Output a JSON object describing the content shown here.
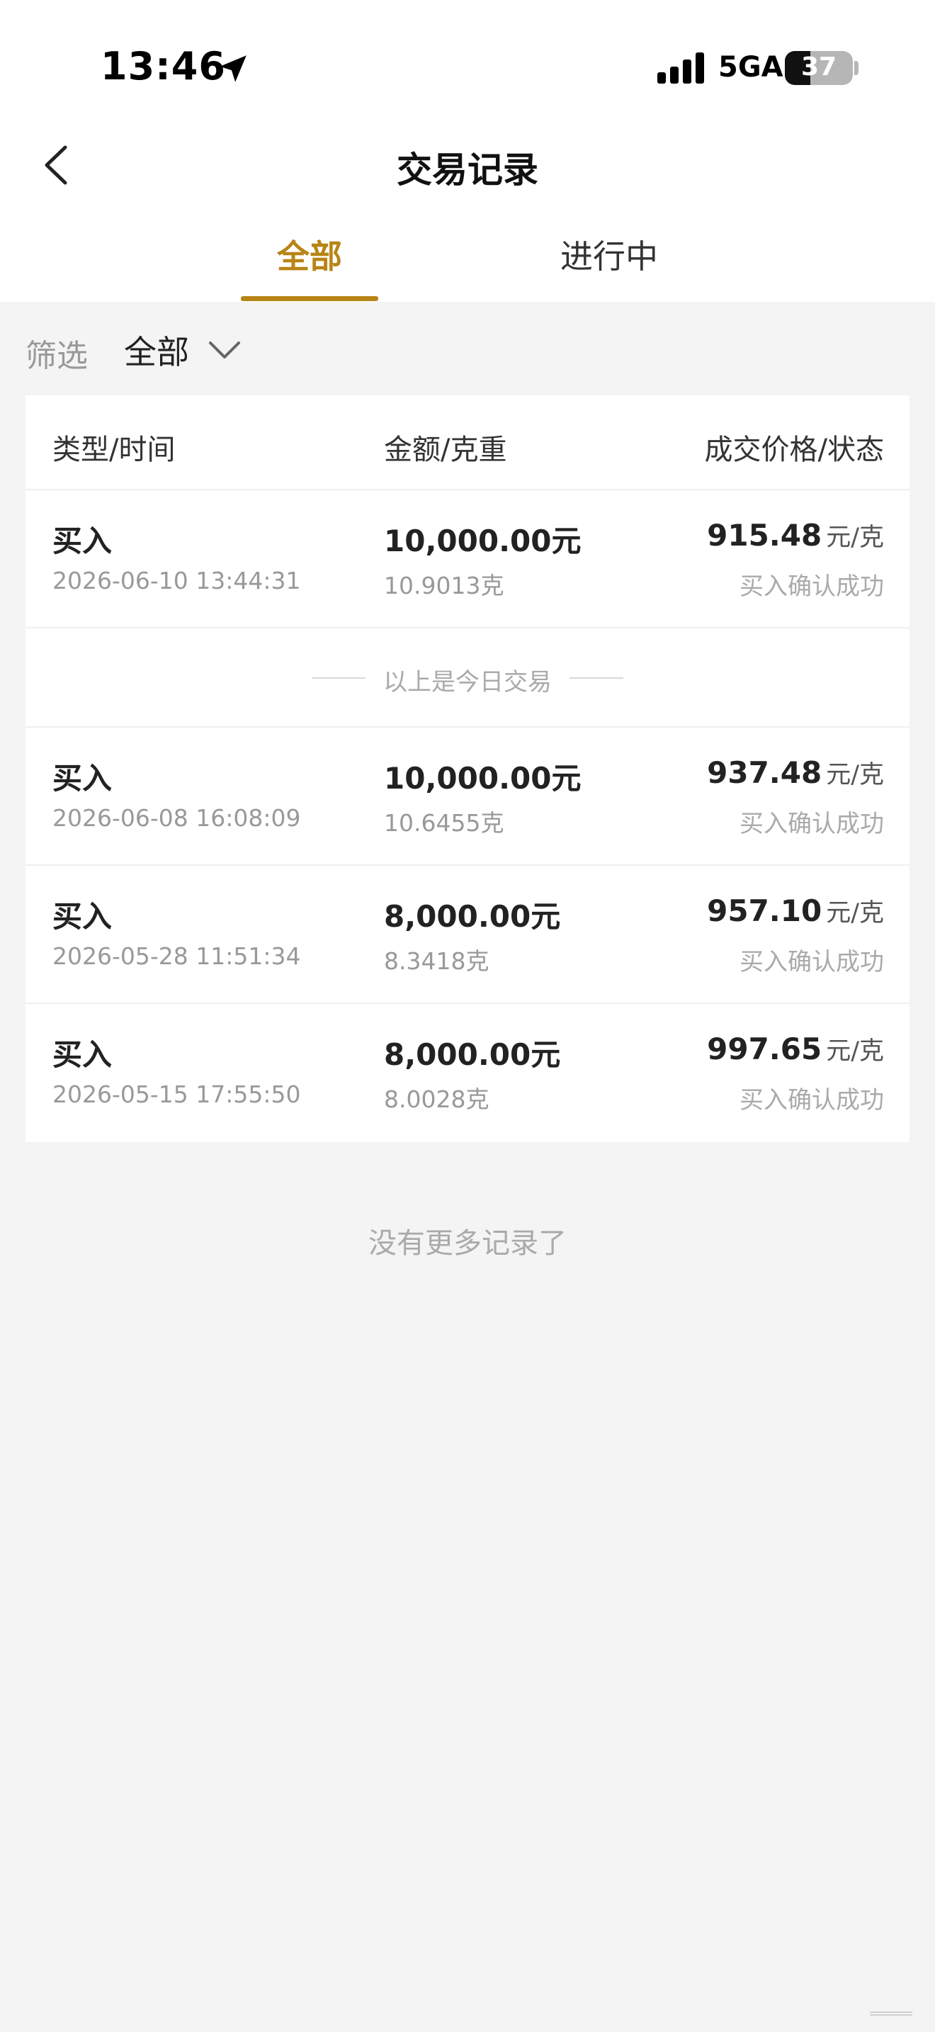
{
  "status_bar": {
    "time": "13:46",
    "network": "5GA",
    "battery": "37"
  },
  "nav": {
    "title": "交易记录"
  },
  "tabs": [
    {
      "label": "全部",
      "active": true
    },
    {
      "label": "进行中",
      "active": false
    }
  ],
  "filter": {
    "label": "筛选",
    "value": "全部"
  },
  "table": {
    "headers": [
      "类型/时间",
      "金额/克重",
      "成交价格/状态"
    ],
    "today_rows": [
      {
        "type": "买入",
        "time": "2026-06-10 13:44:31",
        "amount": "10,000.00元",
        "weight": "10.9013克",
        "price": "915.48",
        "unit": "元/克",
        "status": "买入确认成功"
      }
    ],
    "divider_text": "以上是今日交易",
    "earlier_rows": [
      {
        "type": "买入",
        "time": "2026-06-08 16:08:09",
        "amount": "10,000.00元",
        "weight": "10.6455克",
        "price": "937.48",
        "unit": "元/克",
        "status": "买入确认成功"
      },
      {
        "type": "买入",
        "time": "2026-05-28 11:51:34",
        "amount": "8,000.00元",
        "weight": "8.3418克",
        "price": "957.10",
        "unit": "元/克",
        "status": "买入确认成功"
      },
      {
        "type": "买入",
        "time": "2026-05-15 17:55:50",
        "amount": "8,000.00元",
        "weight": "8.0028克",
        "price": "997.65",
        "unit": "元/克",
        "status": "买入确认成功"
      }
    ]
  },
  "footer": {
    "no_more": "没有更多记录了"
  },
  "colors": {
    "accent": "#b88415",
    "background": "#f4f4f4"
  }
}
